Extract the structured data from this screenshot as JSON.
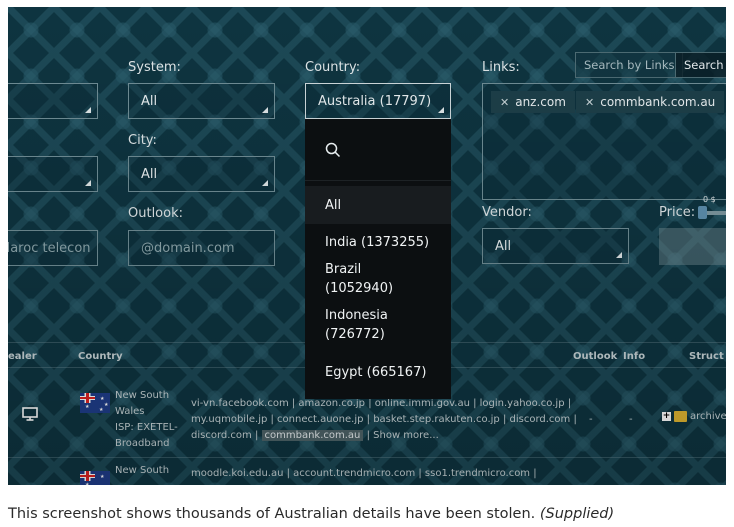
{
  "filters": {
    "system": {
      "label": "System:",
      "value": "All"
    },
    "country": {
      "label": "Country:",
      "value": "Australia (17797)"
    },
    "links": {
      "label": "Links:",
      "chips": [
        "anz.com",
        "commbank.com.au"
      ],
      "search_button": "Search by Links",
      "search_button_2": "Search b"
    },
    "city": {
      "label": "City:",
      "value": "All"
    },
    "outlook": {
      "label": "Outlook:",
      "placeholder": "@domain.com"
    },
    "isp_field": {
      "value": "Maroc telecon"
    },
    "vendor": {
      "label": "Vendor:",
      "value": "All"
    },
    "price": {
      "label": "Price:",
      "min": "0 $"
    }
  },
  "country_dropdown": {
    "items": [
      "All",
      "India (1373255)",
      "Brazil (1052940)",
      "Indonesia (726772)",
      "Egypt (665167)"
    ]
  },
  "table": {
    "headers": {
      "dealer": "ealer",
      "country": "Country",
      "outlook": "Outlook",
      "info": "Info",
      "struct": "Struct"
    },
    "rows": [
      {
        "region_line1": "New South",
        "region_line2": "Wales",
        "isp_line1": "ISP: EXETEL-",
        "isp_line2": "Broadband",
        "links_line1": "vi-vn.facebook.com | amazon.co.jp | online.immi.gov.au | login.yahoo.co.jp |",
        "links_line2": "my.uqmobile.jp | connect.auone.jp | basket.step.rakuten.co.jp | discord.com |",
        "links_line3_prefix": "discord.com |",
        "links_highlight": "commbank.com.au",
        "links_line3_suffix": "| Show more...",
        "outlook": "-",
        "info": "-",
        "struct": "archive"
      },
      {
        "region_line1": "New South",
        "links_line1": "moodle.koi.edu.au | account.trendmicro.com | sso1.trendmicro.com |"
      }
    ]
  },
  "caption": {
    "text": "This screenshot shows thousands of Australian details have been stolen.",
    "source": "(Supplied)"
  }
}
